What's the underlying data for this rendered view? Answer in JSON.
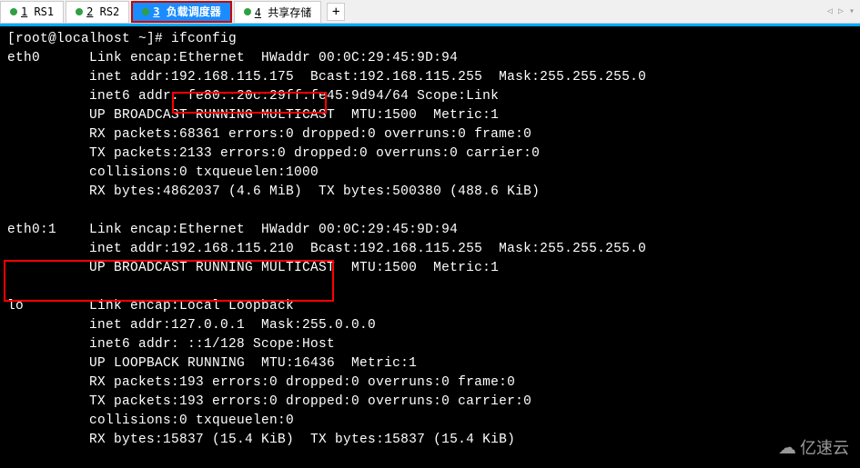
{
  "tabs": {
    "t1_num": "1",
    "t1_label": " RS1",
    "t2_num": "2",
    "t2_label": " RS2",
    "t3_num": "3",
    "t3_label": " 负载调度器",
    "t4_num": "4",
    "t4_label": " 共享存储",
    "add": "+"
  },
  "nav": {
    "left": "◁",
    "right": "▷",
    "down": "▾"
  },
  "terminal": {
    "prompt": "[root@localhost ~]# ",
    "command": "ifconfig",
    "eth0_line1": "eth0      Link encap:Ethernet  HWaddr 00:0C:29:45:9D:94",
    "eth0_line2": "          inet addr:192.168.115.175  Bcast:192.168.115.255  Mask:255.255.255.0",
    "eth0_line3": "          inet6 addr: fe80::20c:29ff:fe45:9d94/64 Scope:Link",
    "eth0_line4": "          UP BROADCAST RUNNING MULTICAST  MTU:1500  Metric:1",
    "eth0_line5": "          RX packets:68361 errors:0 dropped:0 overruns:0 frame:0",
    "eth0_line6": "          TX packets:2133 errors:0 dropped:0 overruns:0 carrier:0",
    "eth0_line7": "          collisions:0 txqueuelen:1000",
    "eth0_line8": "          RX bytes:4862037 (4.6 MiB)  TX bytes:500380 (488.6 KiB)",
    "blank": "",
    "eth01_line1": "eth0:1    Link encap:Ethernet  HWaddr 00:0C:29:45:9D:94",
    "eth01_line2": "          inet addr:192.168.115.210  Bcast:192.168.115.255  Mask:255.255.255.0",
    "eth01_line3": "          UP BROADCAST RUNNING MULTICAST  MTU:1500  Metric:1",
    "lo_line1": "lo        Link encap:Local Loopback",
    "lo_line2": "          inet addr:127.0.0.1  Mask:255.0.0.0",
    "lo_line3": "          inet6 addr: ::1/128 Scope:Host",
    "lo_line4": "          UP LOOPBACK RUNNING  MTU:16436  Metric:1",
    "lo_line5": "          RX packets:193 errors:0 dropped:0 overruns:0 frame:0",
    "lo_line6": "          TX packets:193 errors:0 dropped:0 overruns:0 carrier:0",
    "lo_line7": "          collisions:0 txqueuelen:0",
    "lo_line8": "          RX bytes:15837 (15.4 KiB)  TX bytes:15837 (15.4 KiB)"
  },
  "watermark": {
    "icon": "☁",
    "text": "亿速云"
  }
}
